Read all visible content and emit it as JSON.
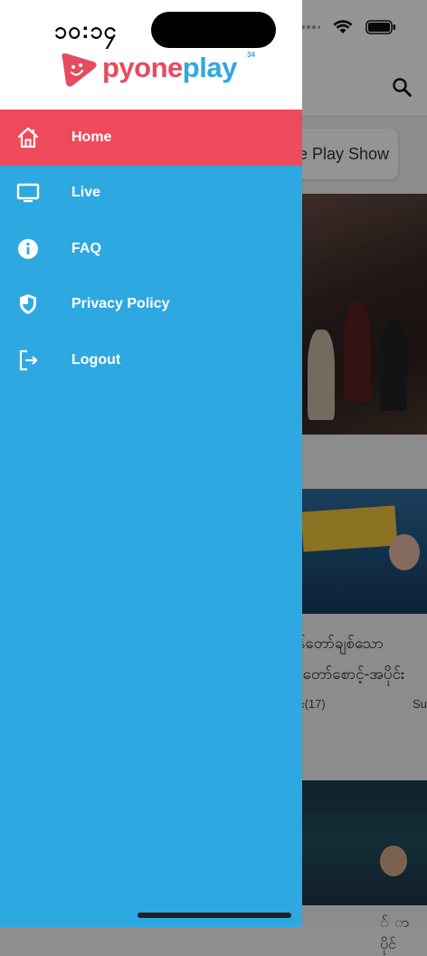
{
  "status_bar": {
    "time": "၁၀:၁၄"
  },
  "app": {
    "brand": {
      "part1": "pyone",
      "part2": "play",
      "superscript": "34"
    },
    "colors": {
      "drawer_bg": "#2ea8e0",
      "active_item_bg": "#ef4a5b",
      "brand_red": "#e84a5f",
      "brand_blue": "#2ea8e0"
    }
  },
  "drawer": {
    "items": [
      {
        "label": "Home",
        "icon": "home-icon",
        "active": true
      },
      {
        "label": "Live",
        "icon": "tv-icon",
        "active": false
      },
      {
        "label": "FAQ",
        "icon": "info-icon",
        "active": false
      },
      {
        "label": "Privacy Policy",
        "icon": "shield-icon",
        "active": false
      },
      {
        "label": "Logout",
        "icon": "logout-icon",
        "active": false
      }
    ]
  },
  "background": {
    "chip_label": "e Play Show",
    "card2_title_line1": "ုန်တော်ချစ်သော",
    "card2_title_line2": "က်တော်စောင့်-အပိုင်း",
    "card2_meta": "ိုင်း(17)",
    "card2_meta_right": "Su",
    "card3_title": "် ာ ပိုင်"
  }
}
